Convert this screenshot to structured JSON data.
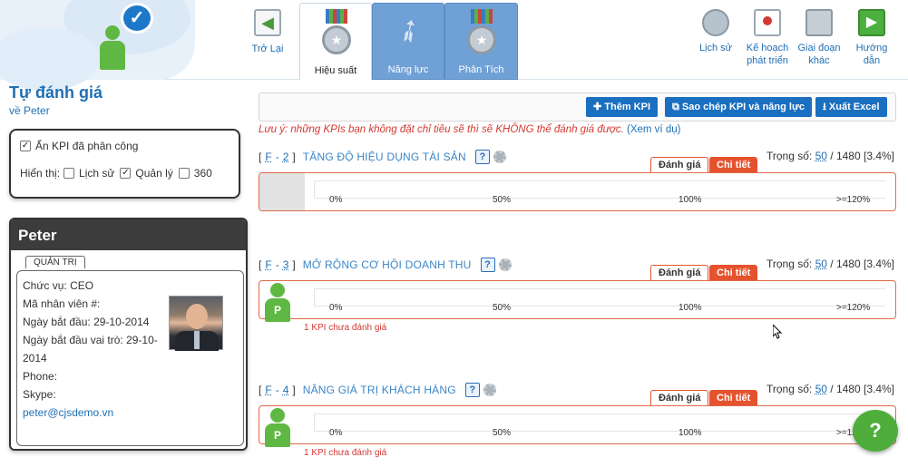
{
  "header": {
    "back_label": "Trở Lại",
    "tabs": [
      {
        "label": "Hiệu suất",
        "active": true
      },
      {
        "label": "Năng lực",
        "active": false
      },
      {
        "label": "Phân Tích",
        "active": false
      }
    ],
    "actions": [
      {
        "label": "Lịch sử",
        "icon": "history-icon"
      },
      {
        "label": "Kế hoạch phát triển",
        "icon": "plan-icon"
      },
      {
        "label": "Giai đoạn khác",
        "icon": "cabinet-icon"
      },
      {
        "label": "Hướng dẫn",
        "icon": "play-icon"
      }
    ]
  },
  "page": {
    "title": "Tự đánh giá",
    "subtitle": "về Peter"
  },
  "filters": {
    "hide_assigned_kpi": "Ẩn KPI đã phân công",
    "show_label": "Hiển thị:",
    "options": [
      {
        "label": "Lịch sử",
        "checked": false
      },
      {
        "label": "Quản lý",
        "checked": true
      },
      {
        "label": "360",
        "checked": false
      }
    ]
  },
  "profile": {
    "name": "Peter",
    "tab": "QUẢN TRỊ",
    "position_label": "Chức vụ:",
    "position": "CEO",
    "employee_id_label": "Mã nhân viên #:",
    "start_date_label": "Ngày bắt đầu:",
    "start_date": "29-10-2014",
    "role_start_label": "Ngày bắt đầu vai trò:",
    "role_start": "29-10-2014",
    "phone_label": "Phone:",
    "skype_label": "Skype:",
    "email": "peter@cjsdemo.vn"
  },
  "toolbar": {
    "add_kpi": "Thêm KPI",
    "copy_kpi": "Sao chép KPI và năng lực",
    "export_excel": "Xuất Excel"
  },
  "note": {
    "text": "Lưu ý: những KPIs bạn không đặt chỉ tiêu sẽ thì sẽ KHÔNG thể đánh giá được.",
    "link": "(Xem ví dụ)"
  },
  "kpis": [
    {
      "code_prefix": "F",
      "code_num": "2",
      "name": "TĂNG ĐỘ HIỆU DỤNG TÀI SẢN",
      "weight": "50",
      "weight_rest": "/ 1480 [3.4%]",
      "pending": ""
    },
    {
      "code_prefix": "F",
      "code_num": "3",
      "name": "MỞ RỘNG CƠ HỘI DOANH THU",
      "weight": "50",
      "weight_rest": "/ 1480 [3.4%]",
      "pending": "1 KPI chưa đánh giá"
    },
    {
      "code_prefix": "F",
      "code_num": "4",
      "name": "NÂNG GIÁ TRỊ KHÁCH HÀNG",
      "weight": "50",
      "weight_rest": "/ 1480 [3.4%]",
      "pending": "1 KPI chưa đánh giá"
    }
  ],
  "kpi_common": {
    "eval_tab": "Đánh giá",
    "detail_tab": "Chi tiết",
    "weight_label": "Trọng số:",
    "help": "?",
    "avatar_letter": "P",
    "ticks": [
      "0%",
      "50%",
      "100%",
      ">=120%"
    ]
  },
  "colors": {
    "accent": "#1f6fb5",
    "button": "#1a6fc0",
    "danger": "#d23a33",
    "tab_orange": "#e5532e",
    "tab_blue": "#6fa0d6",
    "green": "#5fb843"
  }
}
